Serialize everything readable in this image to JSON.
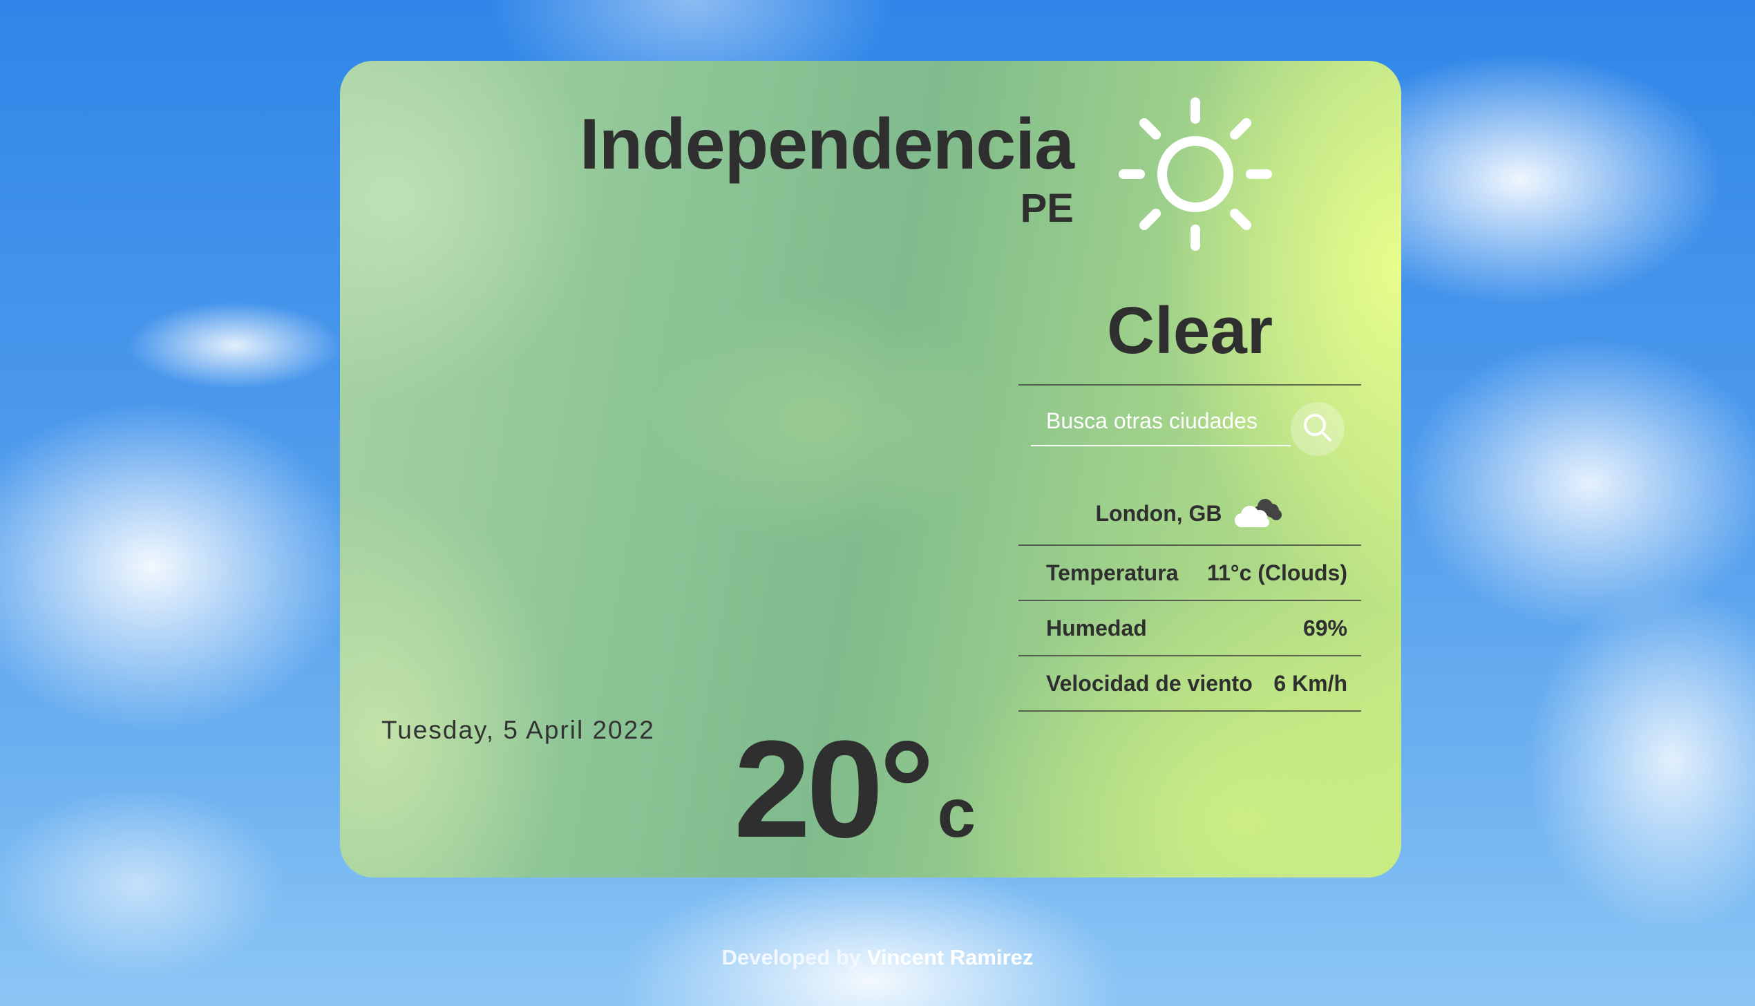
{
  "location": {
    "city": "Independencia",
    "country": "PE"
  },
  "date": "Tuesday, 5 April 2022",
  "temperature": {
    "value": "20°",
    "unit": "c"
  },
  "weather": {
    "condition": "Clear",
    "icon": "sun-icon"
  },
  "search": {
    "placeholder": "Busca otras ciudades",
    "value": "",
    "button_icon": "search-icon"
  },
  "other_city": {
    "name": "London, GB",
    "icon": "clouds-icon",
    "details": [
      {
        "label": "Temperatura",
        "value": "11°c (Clouds)"
      },
      {
        "label": "Humedad",
        "value": "69%"
      },
      {
        "label": "Velocidad de viento",
        "value": "6 Km/h"
      }
    ]
  },
  "footer": {
    "prefix": "Developed by",
    "author": "Vincent Ramirez"
  },
  "colors": {
    "text_dark": "#2f2f2f",
    "card_green": "#8dc596",
    "card_yellow": "#c4e883",
    "sky_blue": "#2f86e8"
  }
}
